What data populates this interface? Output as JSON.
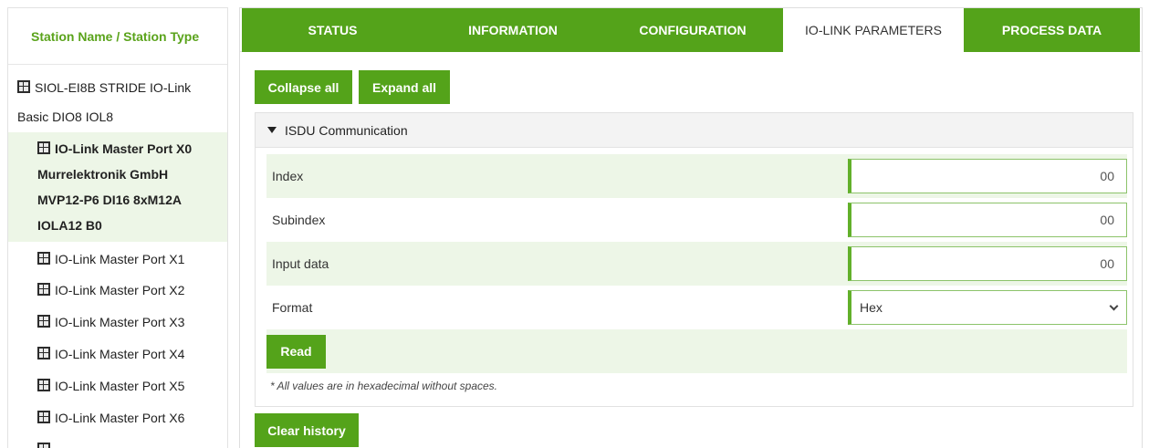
{
  "sidebar": {
    "header": "Station Name / Station Type",
    "root": {
      "line1": "SIOL-EI8B STRIDE IO-Link",
      "line2": "Basic DIO8 IOL8",
      "icon": "device-icon"
    },
    "selected": {
      "line1": "IO-Link Master Port X0",
      "line2": "Murrelektronik GmbH",
      "line3": "MVP12-P6 DI16 8xM12A",
      "line4": "IOLA12 B0"
    },
    "ports": [
      "IO-Link Master Port X1",
      "IO-Link Master Port X2",
      "IO-Link Master Port X3",
      "IO-Link Master Port X4",
      "IO-Link Master Port X5",
      "IO-Link Master Port X6"
    ]
  },
  "tabs": [
    "STATUS",
    "INFORMATION",
    "CONFIGURATION",
    "IO-LINK PARAMETERS",
    "PROCESS DATA"
  ],
  "active_tab": "IO-LINK PARAMETERS",
  "buttons": {
    "collapse": "Collapse all",
    "expand": "Expand all",
    "read": "Read",
    "clear": "Clear history"
  },
  "isdu": {
    "title": "ISDU Communication",
    "index_label": "Index",
    "index_value": "00",
    "subindex_label": "Subindex",
    "subindex_value": "00",
    "input_label": "Input data",
    "input_value": "00",
    "format_label": "Format",
    "format_value": "Hex",
    "note": "* All values are in hexadecimal without spaces."
  },
  "colors": {
    "accent": "#54a31a",
    "selected_bg": "#edf6e7",
    "header_text": "#5aa31b"
  }
}
